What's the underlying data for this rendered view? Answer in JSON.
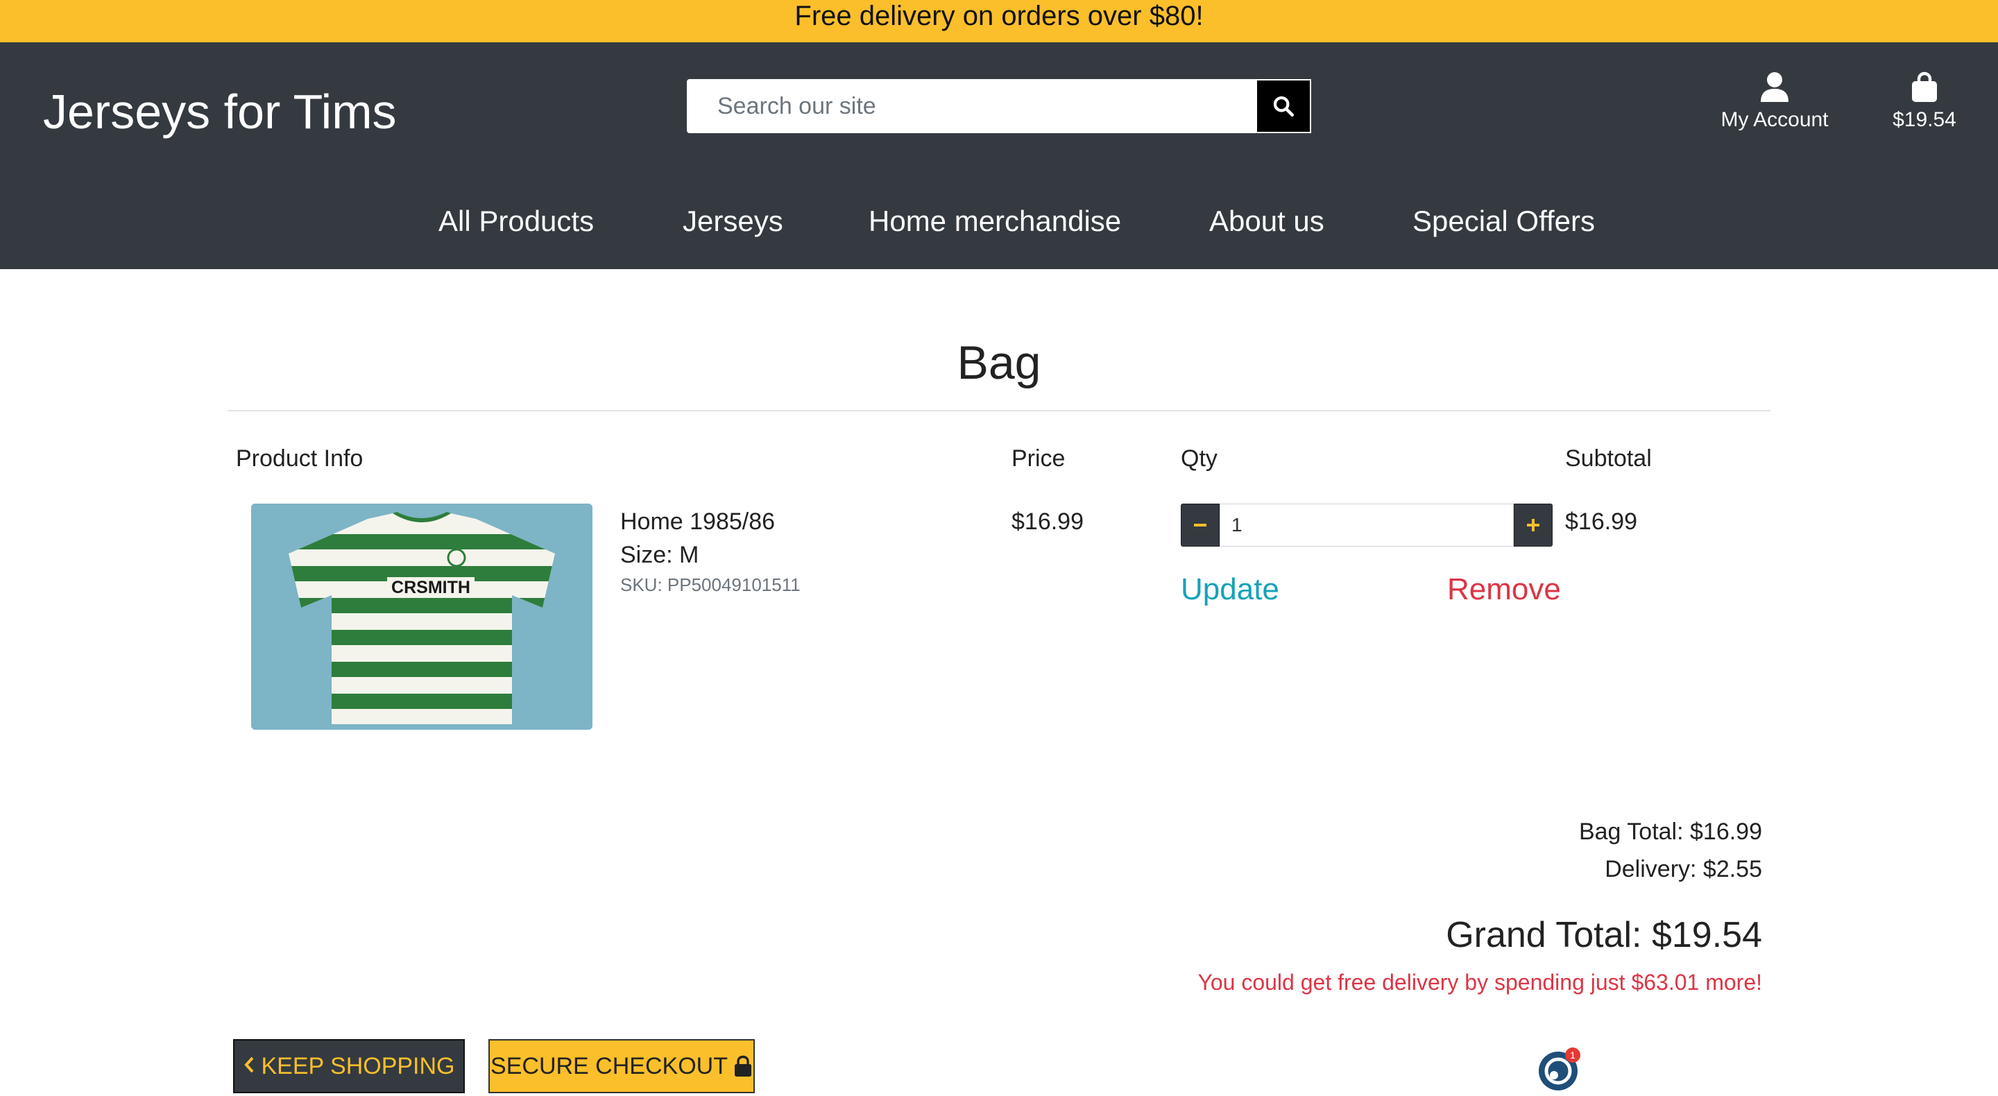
{
  "banner": {
    "text": "Free delivery on orders over $80!"
  },
  "header": {
    "logo": "Jerseys for Tims",
    "search_placeholder": "Search our site",
    "account_label": "My Account",
    "bag_total": "$19.54"
  },
  "nav": {
    "items": [
      "All Products",
      "Jerseys",
      "Home merchandise",
      "About us",
      "Special Offers"
    ]
  },
  "page": {
    "title": "Bag"
  },
  "table": {
    "headers": {
      "product": "Product Info",
      "price": "Price",
      "qty": "Qty",
      "subtotal": "Subtotal"
    }
  },
  "item": {
    "name": "Home 1985/86",
    "size": "Size: M",
    "sku": "SKU: PP50049101511",
    "price": "$16.99",
    "qty": "1",
    "subtotal": "$16.99",
    "update_label": "Update",
    "remove_label": "Remove",
    "image_text": "CRSMITH"
  },
  "summary": {
    "bag_total": "Bag Total: $16.99",
    "delivery": "Delivery: $2.55",
    "grand_total": "Grand Total: $19.54",
    "free_delivery_msg": "You could get free delivery by spending just $63.01 more!"
  },
  "buttons": {
    "keep_shopping": "KEEP SHOPPING",
    "secure_checkout": "SECURE CHECKOUT"
  },
  "chat": {
    "badge": "1"
  },
  "colors": {
    "accent": "#fbbf2b",
    "header_bg": "#343a40",
    "update": "#17a2b8",
    "danger": "#dc3545"
  },
  "icons": [
    "search-icon",
    "user-icon",
    "shopping-bag-icon",
    "minus-icon",
    "plus-icon",
    "chevron-left-icon",
    "lock-icon",
    "chat-widget-icon"
  ]
}
